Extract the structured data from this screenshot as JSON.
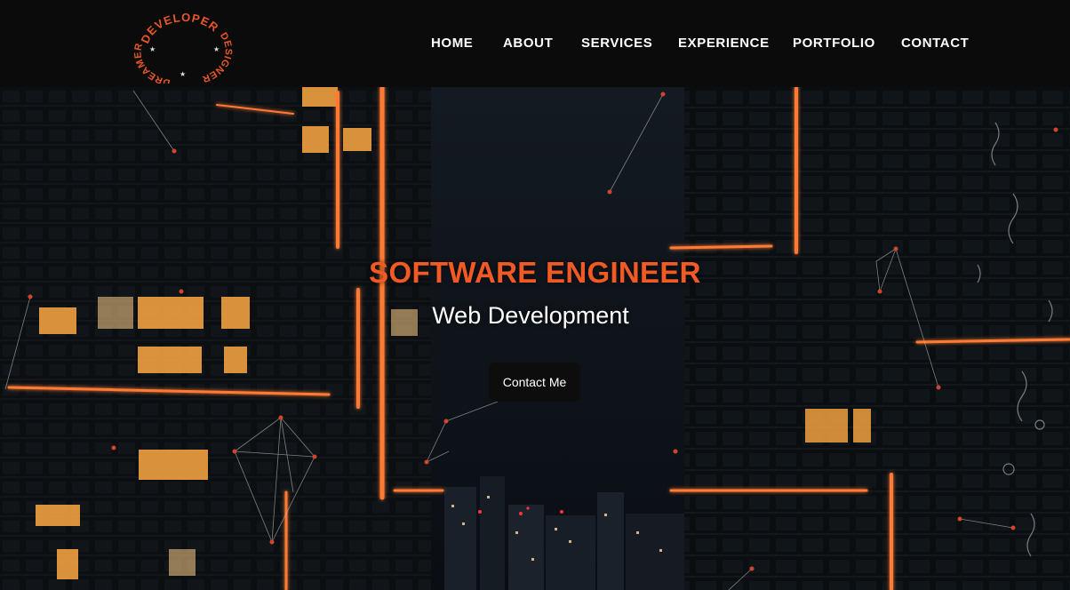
{
  "brand": {
    "logo_text_top": "DEVELOPER",
    "logo_text_right": "DESIGNER",
    "logo_text_left": "DREAMER",
    "accent_color": "#e8572a"
  },
  "nav": {
    "items": [
      {
        "label": "HOME"
      },
      {
        "label": "ABOUT"
      },
      {
        "label": "SERVICES"
      },
      {
        "label": "EXPERIENCE"
      },
      {
        "label": "PORTFOLIO"
      },
      {
        "label": "CONTACT"
      }
    ]
  },
  "hero": {
    "title": "SOFTWARE ENGINEER",
    "subtitle": "Web Development",
    "cta_label": "Contact Me",
    "title_color": "#f15a24",
    "background": "night city skyline with orange neon lines"
  }
}
